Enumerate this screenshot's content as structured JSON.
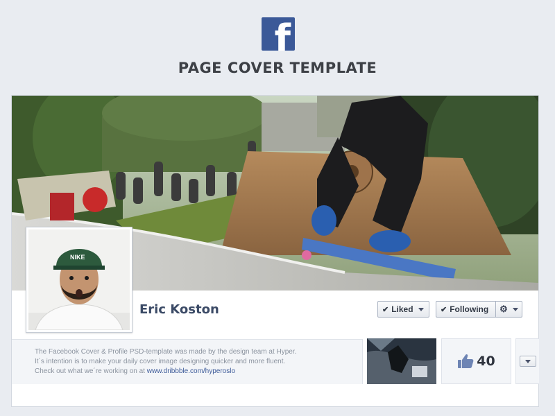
{
  "header": {
    "logo_letter": "f",
    "title": "PAGE COVER TEMPLATE"
  },
  "profile": {
    "name": "Eric Koston",
    "avatar_cap_text": "NIKE"
  },
  "actions": {
    "liked_label": "Liked",
    "following_label": "Following",
    "check_icon": "check-icon",
    "gear_icon": "gear-icon"
  },
  "about": {
    "line1": "The Facebook Cover & Profile PSD-template was made by the design team at Hyper.",
    "line2": "It´s intention is to make your daily cover image designing quicker and more fluent.",
    "line3_prefix": "Check out what we´re working on at ",
    "link": "www.dribbble.com/hyperoslo"
  },
  "likes": {
    "count": "40",
    "icon": "thumbs-up-icon"
  },
  "colors": {
    "facebook_blue": "#3b5998",
    "background": "#e9ecf1",
    "name_text": "#3b4a66"
  }
}
